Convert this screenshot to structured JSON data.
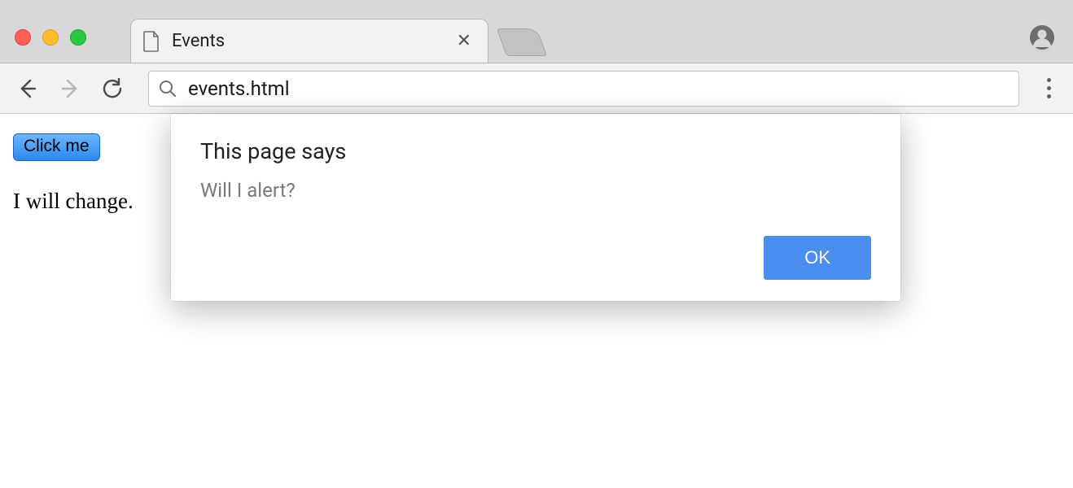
{
  "chrome": {
    "tab_title": "Events",
    "url": "events.html"
  },
  "page": {
    "button_label": "Click me",
    "paragraph": "I will change."
  },
  "dialog": {
    "title": "This page says",
    "message": "Will I alert?",
    "ok_label": "OK"
  }
}
